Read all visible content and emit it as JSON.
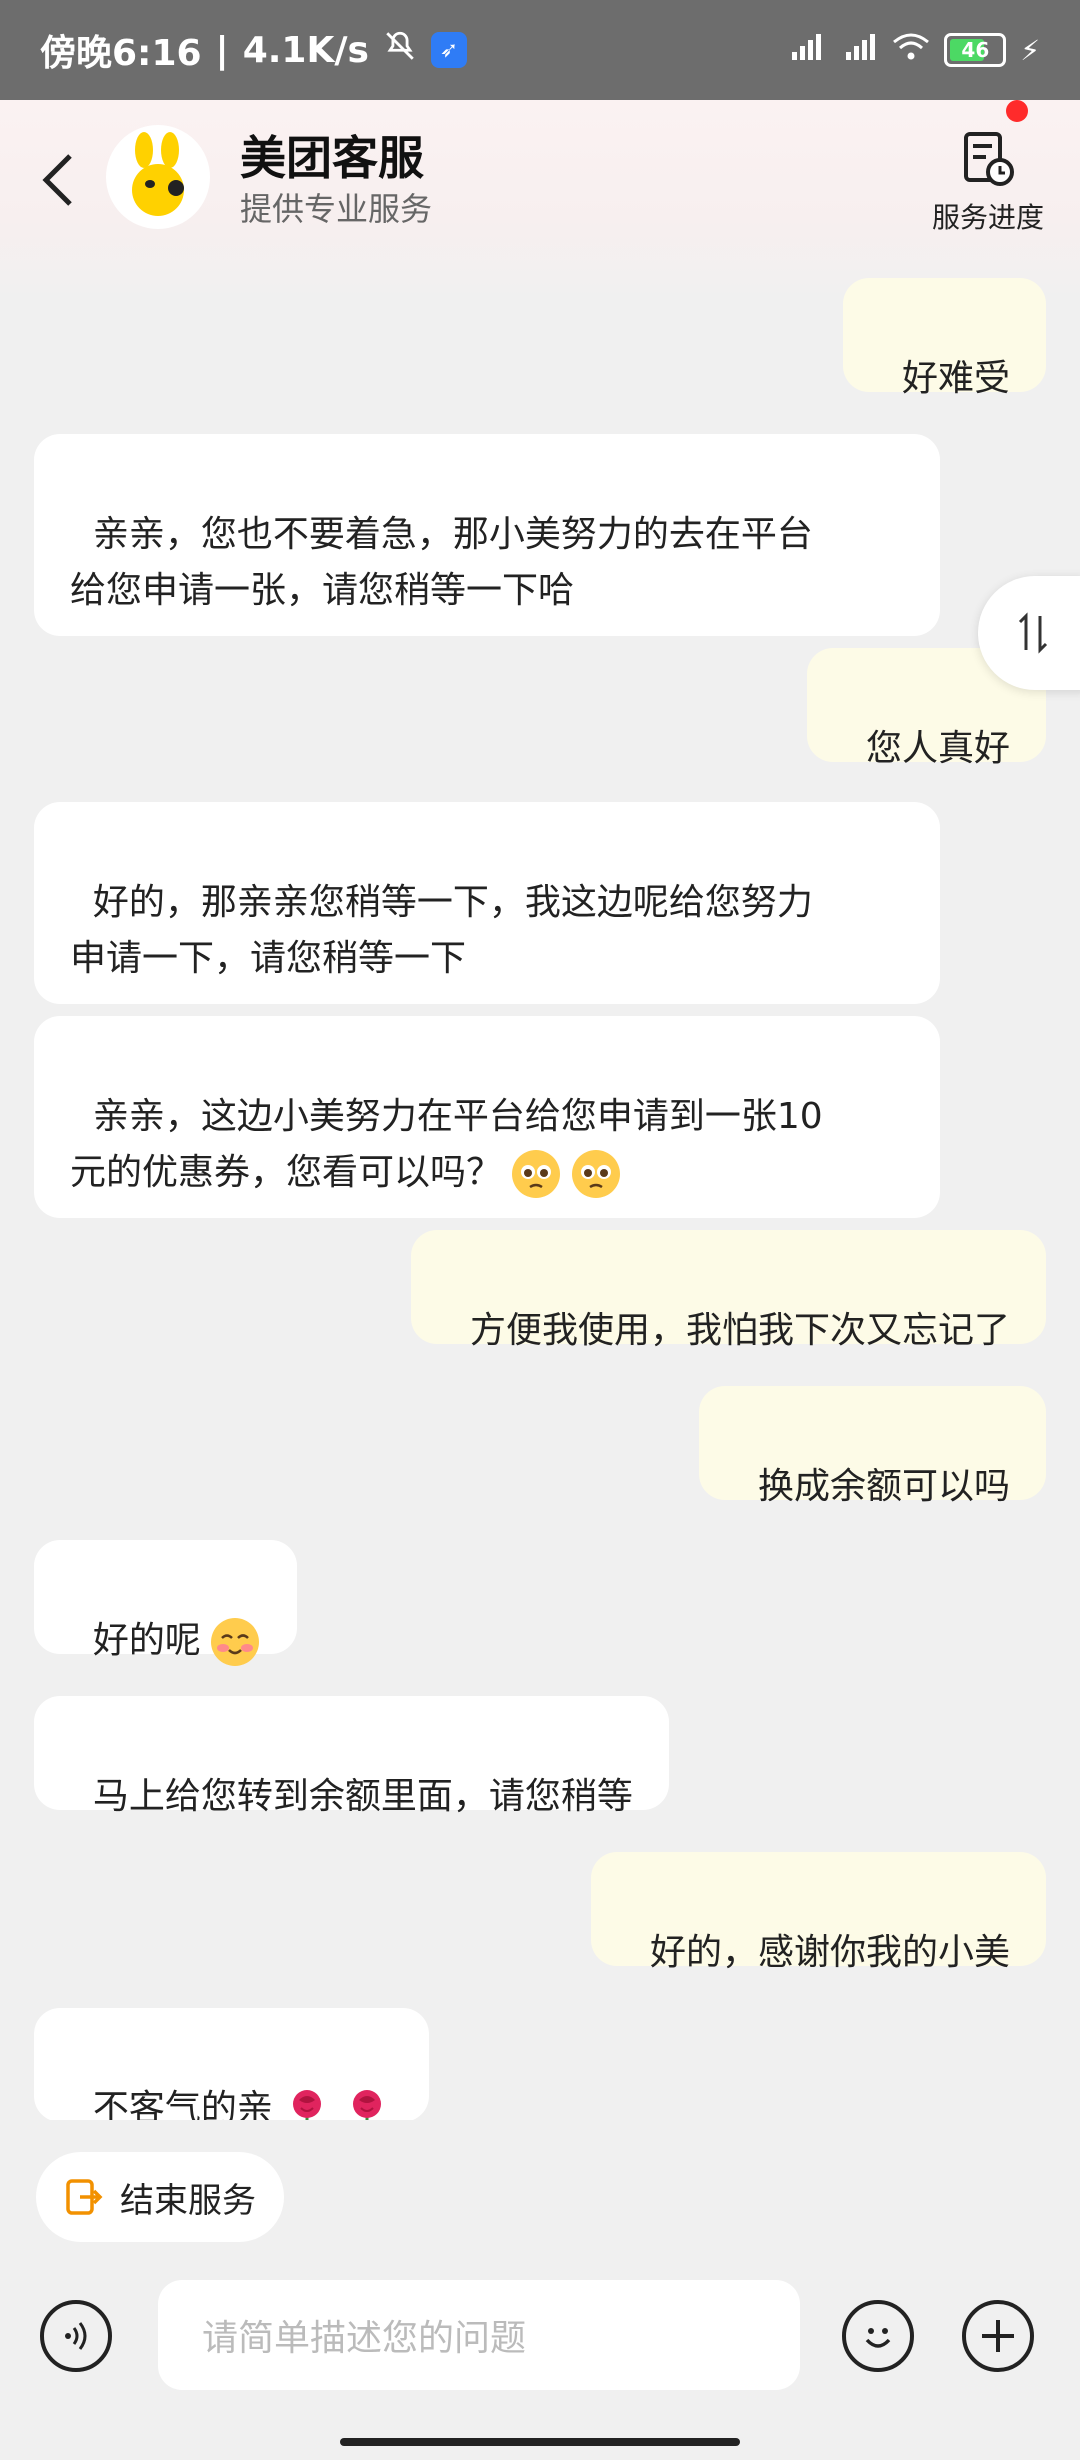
{
  "status_bar": {
    "time": "傍晚6:16",
    "separator": "|",
    "net_speed": "4.1K/s",
    "battery_level": "46",
    "icons": [
      "mute-icon",
      "app-rocket-icon",
      "signal-icon",
      "signal-icon",
      "wifi-icon",
      "battery-icon",
      "charging-icon"
    ]
  },
  "header": {
    "title": "美团客服",
    "subtitle": "提供专业服务",
    "progress_label": "服务进度",
    "brand_color": "#ffd100"
  },
  "messages": [
    {
      "from": "user",
      "text": "好难受"
    },
    {
      "from": "agent",
      "text": "亲亲，您也不要着急，那小美努力的去在平台\n给您申请一张，请您稍等一下哈"
    },
    {
      "from": "user",
      "text": "您人真好"
    },
    {
      "from": "agent",
      "text": "好的，那亲亲您稍等一下，我这边呢给您努力\n申请一下，请您稍等一下"
    },
    {
      "from": "agent",
      "text": "亲亲，这边小美努力在平台给您申请到一张10\n元的优惠券，您看可以吗？",
      "emojis": [
        "pleading-emoji",
        "pleading-emoji"
      ]
    },
    {
      "from": "user",
      "text": "方便我使用，我怕我下次又忘记了"
    },
    {
      "from": "user",
      "text": "换成余额可以吗"
    },
    {
      "from": "agent",
      "text": "好的呢",
      "emojis": [
        "blushing-emoji"
      ]
    },
    {
      "from": "agent",
      "text": "马上给您转到余额里面，请您稍等"
    },
    {
      "from": "user",
      "text": "好的，感谢你我的小美"
    },
    {
      "from": "agent",
      "text": "不客气的亲",
      "emojis": [
        "rose-emoji",
        "rose-emoji"
      ]
    }
  ],
  "bottom": {
    "end_service_label": "结束服务",
    "input_placeholder": "请简单描述您的问题"
  },
  "colors": {
    "user_bubble": "#fdfbe7",
    "agent_bubble": "#ffffff",
    "accent_orange": "#f29100",
    "badge_red": "#ff2b2b"
  }
}
